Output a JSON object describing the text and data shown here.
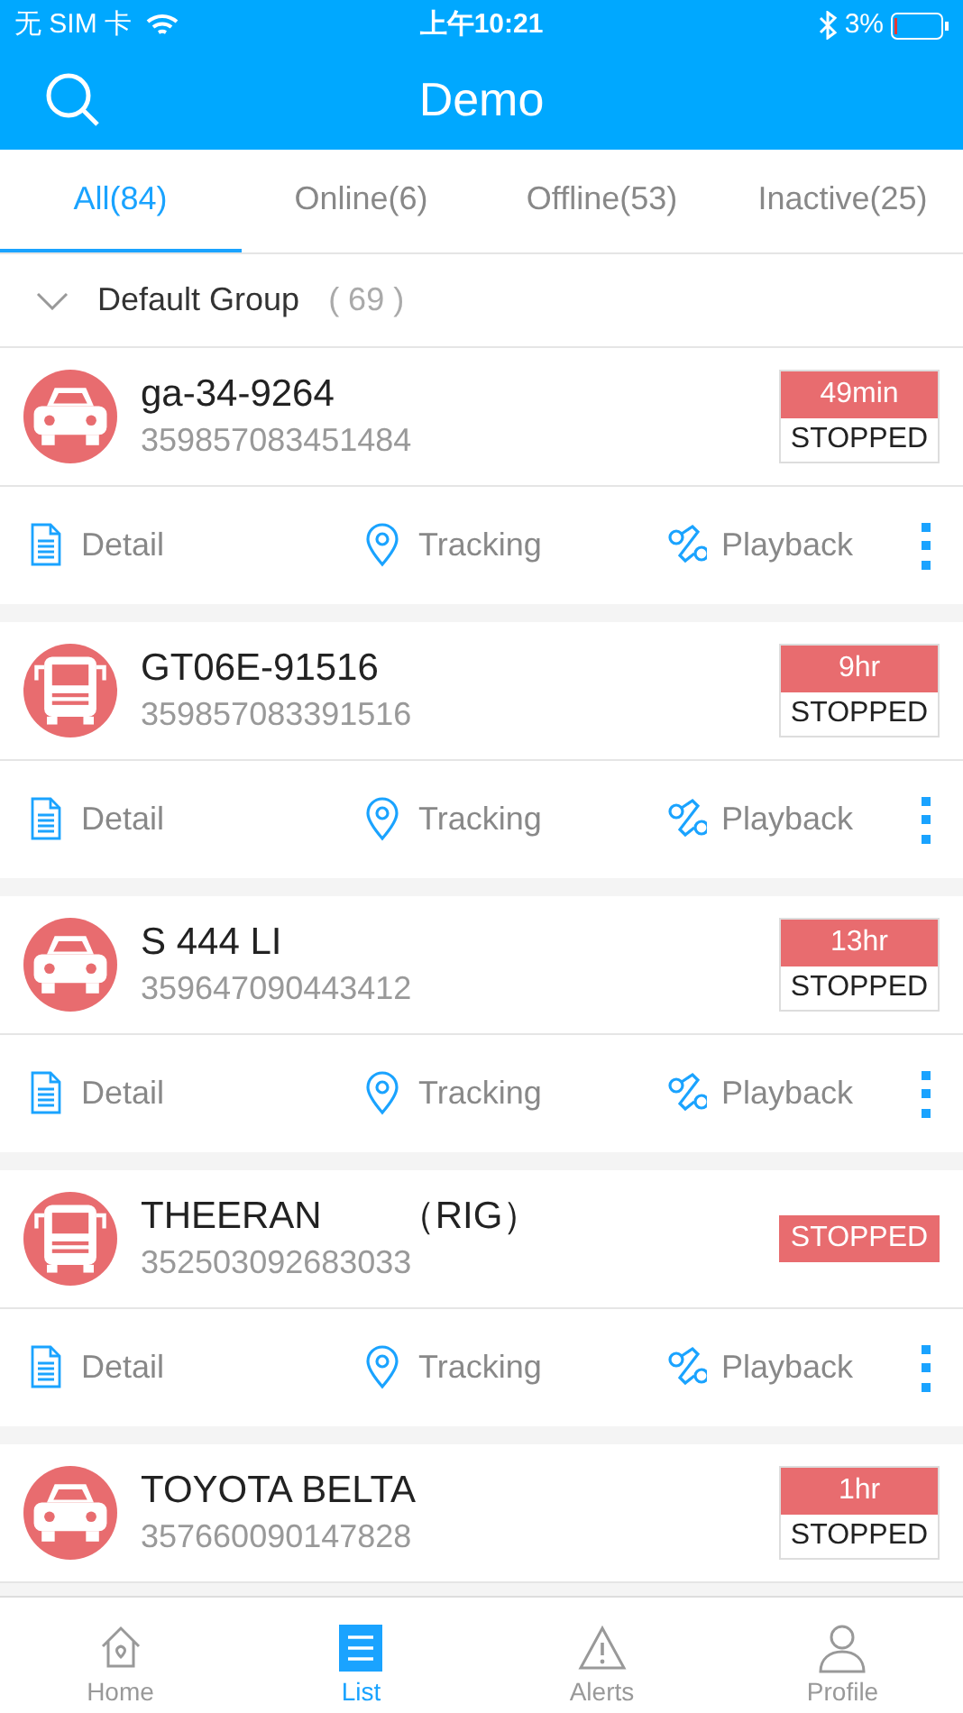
{
  "status_bar": {
    "carrier": "无 SIM 卡",
    "time": "上午10:21",
    "battery": "3%"
  },
  "header": {
    "title": "Demo"
  },
  "tabs": [
    {
      "label": "All(84)",
      "selected": true
    },
    {
      "label": "Online(6)",
      "selected": false
    },
    {
      "label": "Offline(53)",
      "selected": false
    },
    {
      "label": "Inactive(25)",
      "selected": false
    }
  ],
  "group": {
    "name": "Default Group",
    "count": "( 69 )",
    "expanded": true
  },
  "vehicles": [
    {
      "kind": "car",
      "name": "ga-34-9264",
      "imei": "359857083451484",
      "duration": "49min",
      "status": "STOPPED",
      "actions": [
        "Detail",
        "Tracking",
        "Playback"
      ]
    },
    {
      "kind": "bus",
      "name": "GT06E-91516",
      "imei": "359857083391516",
      "duration": "9hr",
      "status": "STOPPED",
      "actions": [
        "Detail",
        "Tracking",
        "Playback"
      ]
    },
    {
      "kind": "car",
      "name": "S 444 LI",
      "imei": "359647090443412",
      "duration": "13hr",
      "status": "STOPPED",
      "actions": [
        "Detail",
        "Tracking",
        "Playback"
      ]
    },
    {
      "kind": "bus",
      "name": "THEERAN　　（RIG）",
      "imei": "352503092683033",
      "status": "STOPPED",
      "actions": [
        "Detail",
        "Tracking",
        "Playback"
      ]
    },
    {
      "kind": "car",
      "name": "TOYOTA BELTA",
      "imei": "357660090147828",
      "duration": "1hr",
      "status": "STOPPED"
    }
  ],
  "bottom_nav": [
    {
      "label": "Home",
      "selected": false
    },
    {
      "label": "List",
      "selected": true
    },
    {
      "label": "Alerts",
      "selected": false
    },
    {
      "label": "Profile",
      "selected": false
    }
  ]
}
